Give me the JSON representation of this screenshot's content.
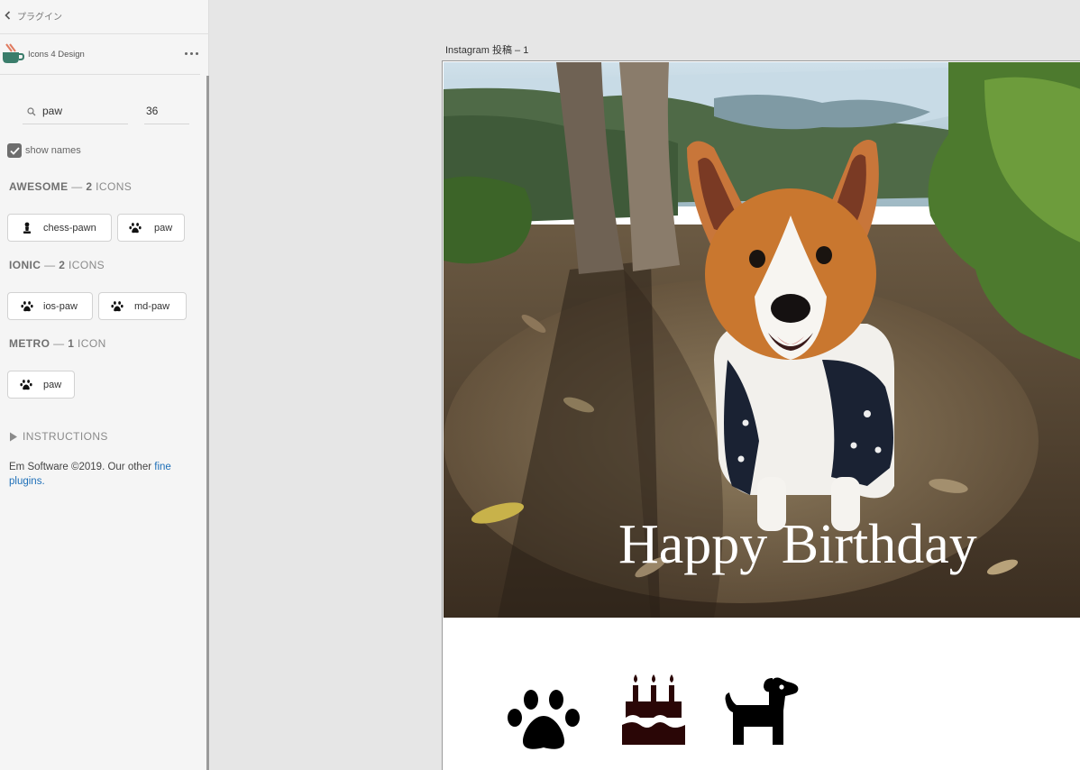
{
  "panel": {
    "back_label": "プラグイン",
    "plugin_name": "Icons 4 Design",
    "search": {
      "value": "paw",
      "placeholder": ""
    },
    "size": {
      "value": "36"
    },
    "show_names": {
      "label": "show names",
      "checked": true
    },
    "sections": [
      {
        "name": "AWESOME",
        "count": "2",
        "unit": "ICONS",
        "icons": [
          {
            "label": "chess-pawn",
            "icon": "chess-pawn-icon"
          },
          {
            "label": "paw",
            "icon": "paw-icon"
          }
        ]
      },
      {
        "name": "IONIC",
        "count": "2",
        "unit": "ICONS",
        "icons": [
          {
            "label": "ios-paw",
            "icon": "paw-icon"
          },
          {
            "label": "md-paw",
            "icon": "paw-icon"
          }
        ]
      },
      {
        "name": "METRO",
        "count": "1",
        "unit": "ICON",
        "icons": [
          {
            "label": "paw",
            "icon": "paw-icon"
          }
        ]
      }
    ],
    "instructions_label": "INSTRUCTIONS",
    "footer": {
      "text": "Em Software ©2019. Our other ",
      "link": "fine plugins."
    }
  },
  "canvas": {
    "artboard_label": "Instagram 投稿 – 1",
    "photo_title": "Happy Birthday",
    "icons": [
      "paw-icon",
      "birthday-cake-icon",
      "dog-icon"
    ]
  },
  "colors": {
    "accent_link": "#1e6fb8",
    "panel_bg": "#f5f5f5",
    "canvas_bg": "#e6e6e6",
    "cake": "#2a0606"
  }
}
